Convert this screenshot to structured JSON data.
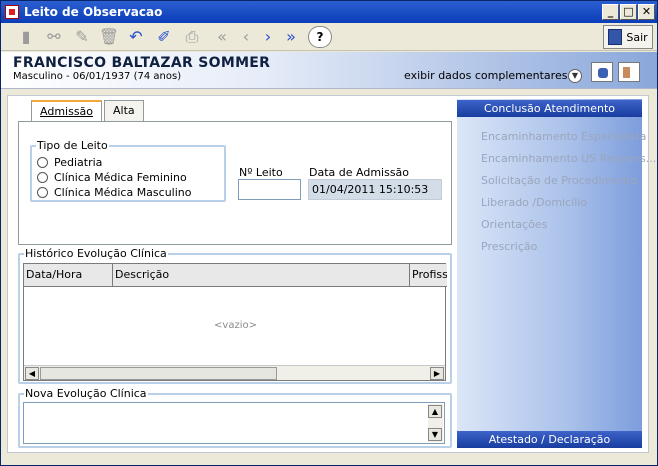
{
  "window": {
    "title": "Leito de Observacao"
  },
  "toolbar": {
    "sair_label": "Sair",
    "help_label": "?"
  },
  "patient": {
    "name": "FRANCISCO BALTAZAR SOMMER",
    "info": "Masculino - 06/01/1937 (74 anos)",
    "extra_label": "exibir dados complementares..."
  },
  "tabs": [
    {
      "label": "Admissão"
    },
    {
      "label": "Alta"
    }
  ],
  "admissao": {
    "tipo_leito_title": "Tipo de Leito",
    "options": [
      "Pediatria",
      "Clínica Médica Feminino",
      "Clínica Médica Masculino"
    ],
    "leito_label": "Nº Leito",
    "leito_value": "",
    "data_label": "Data de Admissão",
    "data_value": "01/04/2011 15:10:53"
  },
  "historico": {
    "title": "Histórico Evolução Clínica",
    "columns": [
      "Data/Hora",
      "Descrição",
      "Profiss"
    ],
    "empty_text": "<vazio>"
  },
  "nova_evolucao": {
    "title": "Nova Evolução Clínica",
    "value": ""
  },
  "side": {
    "header": "Conclusão Atendimento",
    "items": [
      "Encaminhamento Especialista",
      "Encaminhamento US Respons...",
      "Solicitação de Procedimento",
      "Liberado /Domicílio",
      "Orientações",
      "Prescrição"
    ],
    "footer": "Atestado / Declaração"
  },
  "colors": {
    "titlebar": "#0a3db8",
    "side_header": "#1f44a8",
    "disabled_text": "#9aa6bb"
  }
}
